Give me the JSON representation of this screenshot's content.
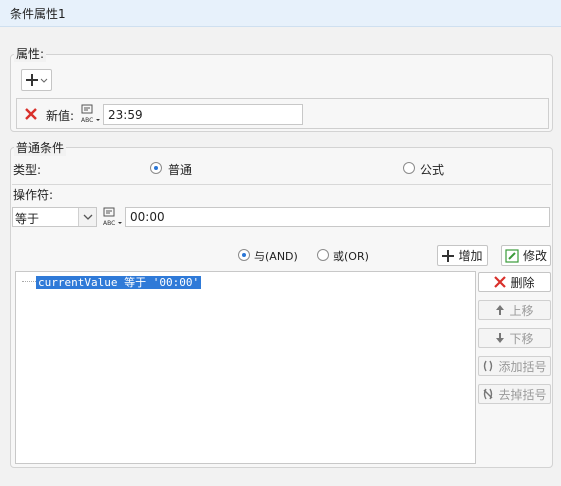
{
  "window": {
    "title": "条件属性1"
  },
  "attributes": {
    "legend": "属性:",
    "new_value_label": "新值:",
    "new_value": "23:59"
  },
  "conditions": {
    "legend": "普通条件",
    "type_label": "类型:",
    "type_normal": "普通",
    "type_formula": "公式",
    "operator_label": "操作符:",
    "operator_value": "等于",
    "operand_value": "00:00",
    "and_label": "与(AND)",
    "or_label": "或(OR)",
    "add_label": "增加",
    "modify_label": "修改",
    "list_item": "currentValue 等于 '00:00'",
    "delete_label": "删除",
    "up_label": "上移",
    "down_label": "下移",
    "add_bracket_label": "添加括号",
    "remove_bracket_label": "去掉括号"
  },
  "colors": {
    "accent": "#2f7ad8",
    "delete_red": "#d9302b",
    "add_green": "#3a9b3a"
  }
}
